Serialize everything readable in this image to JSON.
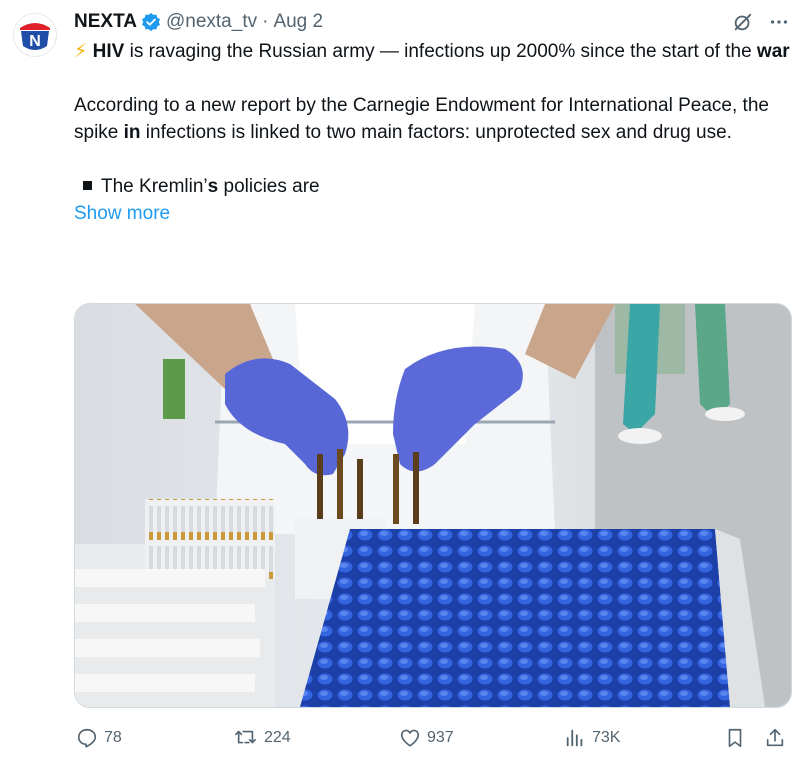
{
  "tweet": {
    "author": {
      "name": "NEXTA",
      "handle": "@nexta_tv",
      "date": "Aug 2",
      "avatar_letter": "N"
    },
    "text": {
      "line1_bold_a": "HIV",
      "line1_rest": " is ravaging the Russian army — infections up 2000% since the start of the ",
      "line1_bold_b": "war",
      "para2_a": "According to a new report by the Carnegie Endowment for International Peace, the spike ",
      "para2_bold": "in",
      "para2_b": " infections is linked to two main factors: unprotected sex and drug use.",
      "para3_a": "The Kremlin’",
      "para3_bold": "s",
      "para3_b": " policies are",
      "show_more": "Show more"
    },
    "stats": {
      "replies": "78",
      "reposts": "224",
      "likes": "937",
      "views": "73K"
    }
  },
  "colors": {
    "accent": "#1d9bf0",
    "muted": "#536471",
    "text": "#0f1419",
    "verified": "#1d9bf0",
    "nexta_red": "#e0202a",
    "nexta_blue": "#1f4ea8"
  },
  "icons": {
    "verified": "verified-badge-icon",
    "grok": "grok-icon",
    "more": "more-icon",
    "reply": "reply-icon",
    "repost": "repost-icon",
    "like": "heart-icon",
    "views": "views-icon",
    "bookmark": "bookmark-icon",
    "share": "share-icon"
  }
}
